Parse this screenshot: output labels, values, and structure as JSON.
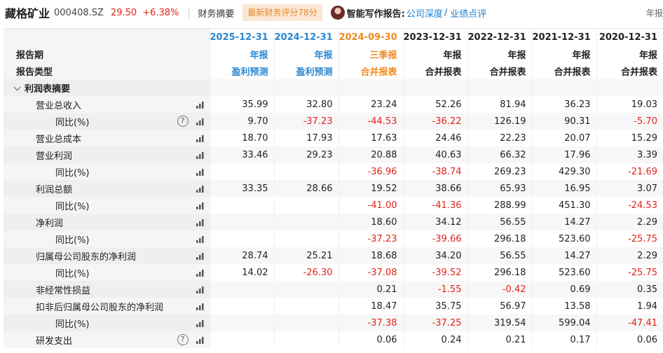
{
  "header": {
    "stock_name": "藏格矿业",
    "stock_code": "000408.SZ",
    "price": "29.50",
    "change": "+6.38%",
    "tab_finance": "财务摘要",
    "score_badge": "最新财务评分78分",
    "ai_label": "智能写作报告:",
    "ai_link_1": "公司深度",
    "ai_sep": "/",
    "ai_link_2": "业绩点评",
    "report_type_tab": "年报"
  },
  "colors": {
    "red": "#e2231a",
    "blue": "#2a87d0",
    "orange": "#ef8a1e",
    "badge_bg": "#fbe7d3"
  },
  "table": {
    "label_period": "报告期",
    "label_type": "报告类型",
    "columns": [
      {
        "date": "2025-12-31",
        "period": "年报",
        "type": "盈利预测",
        "style": "blue"
      },
      {
        "date": "2024-12-31",
        "period": "年报",
        "type": "盈利预测",
        "style": "blue"
      },
      {
        "date": "2024-09-30",
        "period": "三季报",
        "type": "合并报表",
        "style": "orange"
      },
      {
        "date": "2023-12-31",
        "period": "年报",
        "type": "合并报表",
        "style": "plain"
      },
      {
        "date": "2022-12-31",
        "period": "年报",
        "type": "合并报表",
        "style": "plain"
      },
      {
        "date": "2021-12-31",
        "period": "年报",
        "type": "合并报表",
        "style": "plain"
      },
      {
        "date": "2020-12-31",
        "period": "年报",
        "type": "合并报表",
        "style": "plain"
      }
    ],
    "section_title": "利润表摘要",
    "rows": [
      {
        "label": "营业总收入",
        "level": 1,
        "help": false,
        "values": [
          "35.99",
          "32.80",
          "23.24",
          "52.26",
          "81.94",
          "36.23",
          "19.03"
        ]
      },
      {
        "label": "同比(%)",
        "level": 2,
        "help": true,
        "values": [
          "9.70",
          "-37.23",
          "-44.53",
          "-36.22",
          "126.19",
          "90.31",
          "-5.70"
        ]
      },
      {
        "label": "营业总成本",
        "level": 1,
        "help": false,
        "values": [
          "18.70",
          "17.93",
          "17.63",
          "24.46",
          "22.23",
          "20.07",
          "15.29"
        ]
      },
      {
        "label": "营业利润",
        "level": 1,
        "help": false,
        "values": [
          "33.46",
          "29.23",
          "20.88",
          "40.63",
          "66.32",
          "17.96",
          "3.39"
        ]
      },
      {
        "label": "同比(%)",
        "level": 2,
        "help": false,
        "values": [
          "",
          "",
          "-36.96",
          "-38.74",
          "269.23",
          "429.30",
          "-21.69"
        ]
      },
      {
        "label": "利润总额",
        "level": 1,
        "help": false,
        "values": [
          "33.35",
          "28.66",
          "19.52",
          "38.66",
          "65.93",
          "16.95",
          "3.07"
        ]
      },
      {
        "label": "同比(%)",
        "level": 2,
        "help": false,
        "values": [
          "",
          "",
          "-41.00",
          "-41.36",
          "288.99",
          "451.30",
          "-24.53"
        ]
      },
      {
        "label": "净利润",
        "level": 1,
        "help": false,
        "values": [
          "",
          "",
          "18.60",
          "34.12",
          "56.55",
          "14.27",
          "2.29"
        ]
      },
      {
        "label": "同比(%)",
        "level": 2,
        "help": false,
        "values": [
          "",
          "",
          "-37.23",
          "-39.66",
          "296.18",
          "523.60",
          "-25.75"
        ]
      },
      {
        "label": "归属母公司股东的净利润",
        "level": 1,
        "help": false,
        "values": [
          "28.74",
          "25.21",
          "18.68",
          "34.20",
          "56.55",
          "14.27",
          "2.29"
        ]
      },
      {
        "label": "同比(%)",
        "level": 2,
        "help": false,
        "values": [
          "14.02",
          "-26.30",
          "-37.08",
          "-39.52",
          "296.18",
          "523.60",
          "-25.75"
        ]
      },
      {
        "label": "非经常性损益",
        "level": 1,
        "help": false,
        "values": [
          "",
          "",
          "0.21",
          "-1.55",
          "-0.42",
          "0.69",
          "0.35"
        ]
      },
      {
        "label": "扣非后归属母公司股东的净利润",
        "level": 1,
        "help": false,
        "values": [
          "",
          "",
          "18.47",
          "35.75",
          "56.97",
          "13.58",
          "1.94"
        ]
      },
      {
        "label": "同比(%)",
        "level": 2,
        "help": false,
        "values": [
          "",
          "",
          "-37.38",
          "-37.25",
          "319.54",
          "599.04",
          "-47.41"
        ]
      },
      {
        "label": "研发支出",
        "level": 1,
        "help": true,
        "values": [
          "",
          "",
          "0.06",
          "0.24",
          "0.21",
          "0.17",
          "0.06"
        ]
      }
    ]
  }
}
